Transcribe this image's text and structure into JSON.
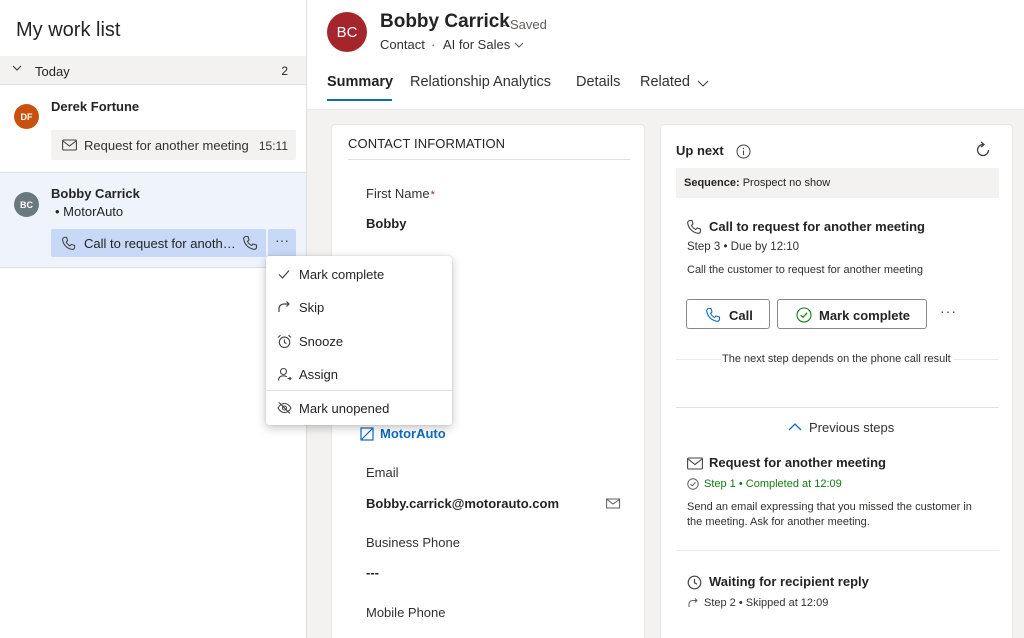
{
  "work_list": {
    "title": "My work list",
    "group": {
      "label": "Today",
      "count": "2"
    },
    "items": [
      {
        "initials": "DF",
        "name": "Derek Fortune",
        "action": "Request for another meeting",
        "time": "15:11"
      },
      {
        "initials": "BC",
        "name": "Bobby Carrick",
        "company": "• MotorAuto",
        "action": "Call to request for another meeting",
        "more": "···"
      }
    ]
  },
  "menu": {
    "items": [
      {
        "label": "Mark complete",
        "icon": "check-icon"
      },
      {
        "label": "Skip",
        "icon": "skip-icon"
      },
      {
        "label": "Snooze",
        "icon": "alarm-icon"
      },
      {
        "label": "Assign",
        "icon": "person-icon"
      },
      {
        "label": "Mark unopened",
        "icon": "eye-off-icon"
      }
    ]
  },
  "record": {
    "initials": "BC",
    "name": "Bobby Carrick",
    "saved": "- Saved",
    "type": "Contact",
    "separator": "·",
    "form": "AI for Sales"
  },
  "tabs": [
    "Summary",
    "Relationship Analytics",
    "Details",
    "Related"
  ],
  "contact_info": {
    "title": "CONTACT INFORMATION",
    "first_name_label": "First Name",
    "required_mark": "*",
    "first_name_value": "Bobby",
    "company": "MotorAuto",
    "email_label": "Email",
    "email_value": "Bobby.carrick@motorauto.com",
    "business_phone_label": "Business Phone",
    "business_phone_value": "---",
    "mobile_phone_label": "Mobile Phone"
  },
  "up_next": {
    "title": "Up next",
    "sequence_label": "Sequence:",
    "sequence_value": " Prospect no show",
    "step_title": "Call to request for another meeting",
    "step_meta": "Step 3 • Due by 12:10",
    "step_desc": "Call the customer to request for another meeting",
    "call_label": "Call",
    "complete_label": "Mark complete",
    "more": "···",
    "next_note": "The next step depends on the phone call result",
    "previous_label": "Previous steps",
    "previous": [
      {
        "title": "Request for another meeting",
        "status": "Step 1 • Completed at 12:09",
        "desc": "Send an email expressing that you missed the customer in the meeting. Ask for another meeting."
      },
      {
        "title": "Waiting for recipient reply",
        "status": "Step 2 • Skipped at 12:09"
      }
    ]
  },
  "colors": {
    "accent": "#0f6cbd",
    "selected_row": "#eef3fc",
    "action_chip": "#c7d9f6",
    "avatar_df": "#ca5010",
    "avatar_bc_small": "#69797e",
    "avatar_bc_large": "#a4262c",
    "completed": "#107c10"
  }
}
